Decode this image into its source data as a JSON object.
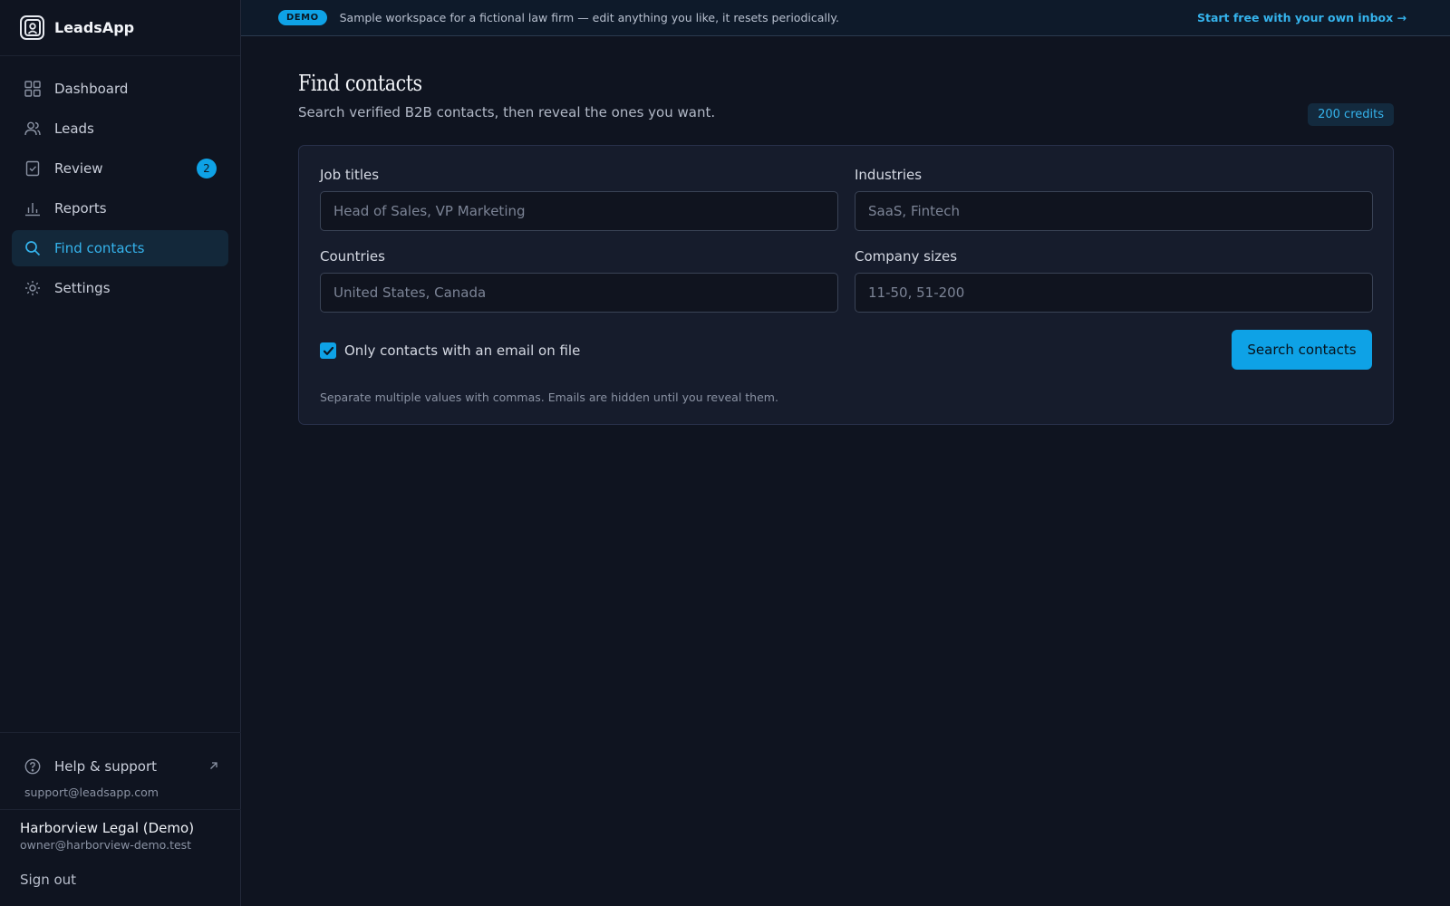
{
  "app": {
    "name": "LeadsApp"
  },
  "sidebar": {
    "items": [
      {
        "label": "Dashboard",
        "icon": "grid-icon"
      },
      {
        "label": "Leads",
        "icon": "users-icon"
      },
      {
        "label": "Review",
        "icon": "checklist-icon",
        "badge": "2"
      },
      {
        "label": "Reports",
        "icon": "bar-chart-icon"
      },
      {
        "label": "Find contacts",
        "icon": "search-icon",
        "active": true
      },
      {
        "label": "Settings",
        "icon": "sun-gear-icon"
      }
    ],
    "help": {
      "label": "Help & support",
      "email": "support@leadsapp.com"
    },
    "account": {
      "name": "Harborview Legal (Demo)",
      "email": "owner@harborview-demo.test",
      "sign_out": "Sign out"
    }
  },
  "banner": {
    "pill": "DEMO",
    "text": "Sample workspace for a fictional law firm — edit anything you like, it resets periodically.",
    "link": "Start free with your own inbox →"
  },
  "main": {
    "title": "Find contacts",
    "subtitle": "Search verified B2B contacts, then reveal the ones you want.",
    "credits": "200 credits",
    "form": {
      "job_titles": {
        "label": "Job titles",
        "placeholder": "Head of Sales, VP Marketing",
        "value": ""
      },
      "industries": {
        "label": "Industries",
        "placeholder": "SaaS, Fintech",
        "value": ""
      },
      "countries": {
        "label": "Countries",
        "placeholder": "United States, Canada",
        "value": ""
      },
      "company_sizes": {
        "label": "Company sizes",
        "placeholder": "11-50, 51-200",
        "value": ""
      },
      "email_only": {
        "label": "Only contacts with an email on file",
        "checked": true
      },
      "submit": "Search contacts",
      "hint": "Separate multiple values with commas. Emails are hidden until you reveal them."
    }
  },
  "colors": {
    "accent": "#0ea2e6",
    "background": "#0f1420",
    "card": "#161c2c"
  }
}
